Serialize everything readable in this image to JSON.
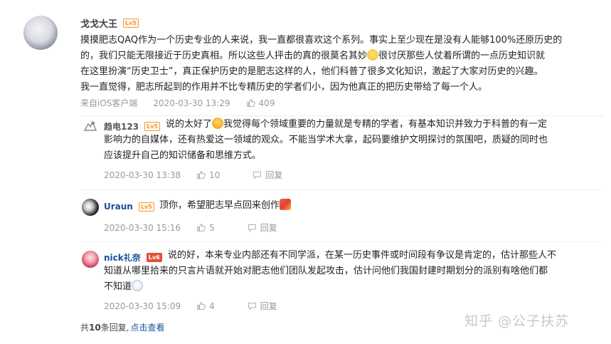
{
  "main_comment": {
    "username": "戈戈大王",
    "level": "Lv5",
    "text_lines": [
      "摸摸肥志QAQ作为一个历史专业的人来说，我一直都很喜欢这个系列。事实上至少现在是没有人能够100%还原历史的",
      "的，我们只能无限接近于历史真相。所以这些人抨击的真的很莫名其妙",
      "很讨厌那些人仗着所谓的一点历史知识就",
      "在这里扮演“历史卫士”，真正保护历史的是肥志这样的人，他们科普了很多文化知识，激起了大家对历史的兴趣。",
      "我一直觉得，肥志所起到的作用并不比专精历史的学者们小，因为他真正的把历史带给了每一个人。"
    ],
    "source": "来自iOS客户端",
    "time": "2020-03-30 13:29",
    "likes": "409"
  },
  "replies": [
    {
      "username": "趋电123",
      "level": "Lv5",
      "text_lines": [
        "说的太好了",
        "我觉得每个领域重要的力量就是专精的学者，有基本知识并致力于科普的有一定",
        "影响力的自媒体，还有热爱这一领域的观众。不能当学术大拿，起码要维护文明探讨的氛围吧，质疑的同时也",
        "应该提升自己的知识储备和思维方式。"
      ],
      "time": "2020-03-30 13:38",
      "likes": "10",
      "reply_label": "回复"
    },
    {
      "username": "Uraun",
      "level": "Lv5",
      "text_lines": [
        "顶你，希望肥志早点回来创作"
      ],
      "time": "2020-03-30 15:16",
      "likes": "5",
      "reply_label": "回复"
    },
    {
      "username": "nick礼奈",
      "level": "Lv6",
      "text_lines": [
        "说的好，本来专业内部还有不同学派，在某一历史事件或时间段有争议是肯定的，估计那些人不",
        "知道从哪里拾来的只言片语就开始对肥志他们团队发起攻击，估计问他们我国封建时期划分的派别有啥他们都",
        "不知道"
      ],
      "time": "2020-03-30 15:09",
      "likes": "4",
      "reply_label": "回复"
    }
  ],
  "footer": {
    "count_prefix": "共",
    "count": "10",
    "count_suffix": "条回复,",
    "view_all": "点击查看"
  },
  "watermark": "知乎 @公子扶苏",
  "colors": {
    "level_badge": "#f29b38",
    "level_badge_high": "#e0503c",
    "link": "#175199",
    "muted": "#999999"
  }
}
